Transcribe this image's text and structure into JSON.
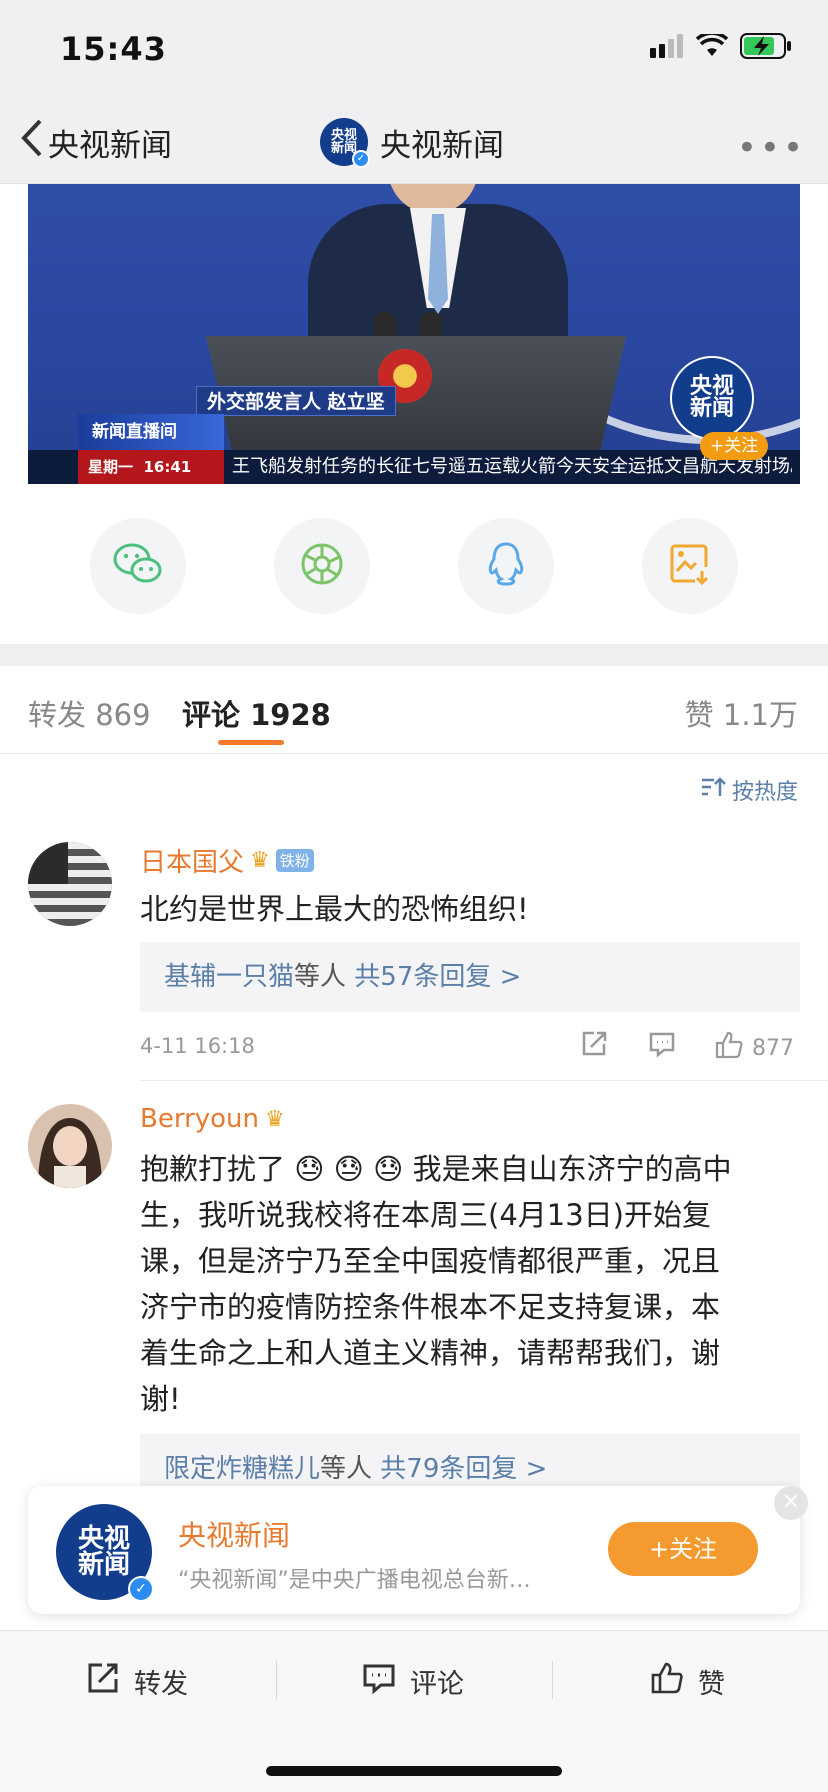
{
  "status": {
    "time": "15:43"
  },
  "nav": {
    "back_label": "央视新闻",
    "title": "央视新闻",
    "logo_top": "央视",
    "logo_bottom": "新闻",
    "more": "•••"
  },
  "video": {
    "speaker_caption": "外交部发言人  赵立坚",
    "live_label": "新闻直播间",
    "ticker_time": "星期一  16:41",
    "ticker_text": "王飞船发射任务的长征七号遥五运载火箭今天安全运抵文昌航天发射场。",
    "logo_top": "央视",
    "logo_bottom": "新闻",
    "follow_label": "+关注"
  },
  "share": {
    "items": [
      "wechat-icon",
      "moments-icon",
      "qq-icon",
      "save-image-icon"
    ]
  },
  "tabs": {
    "repost_label": "转发",
    "repost_count": "869",
    "comment_label": "评论",
    "comment_count": "1928",
    "like_label": "赞",
    "like_count": "1.1万"
  },
  "sort": {
    "label": "按热度"
  },
  "comments": [
    {
      "name": "日本国父",
      "badge": "铁粉",
      "text": "北约是世界上最大的恐怖组织!",
      "reply_who": "基辅一只猫",
      "reply_others": "等人",
      "reply_count": "共57条回复 >",
      "date": "4-11 16:18",
      "likes": "877"
    },
    {
      "name": "Berryoun",
      "text_lines": [
        "抱歉打扰了 😓 😓 😓 我是来自山东济宁的高中",
        "生，我听说我校将在本周三(4月13日)开始复",
        "课，但是济宁乃至全中国疫情都很严重，况且",
        "济宁市的疫情防控条件根本不足支持复课，本",
        "着生命之上和人道主义精神，请帮帮我们，谢",
        "谢!"
      ],
      "reply_who": "限定炸糖糕儿",
      "reply_others": "等人",
      "reply_count": "共79条回复 >"
    }
  ],
  "banner": {
    "name": "央视新闻",
    "desc": "“央视新闻”是中央广播电视总台新…",
    "follow_label": "+关注",
    "close": "×",
    "logo_top": "央视",
    "logo_bottom": "新闻"
  },
  "bottom_bar": {
    "repost": "转发",
    "comment": "评论",
    "like": "赞"
  }
}
